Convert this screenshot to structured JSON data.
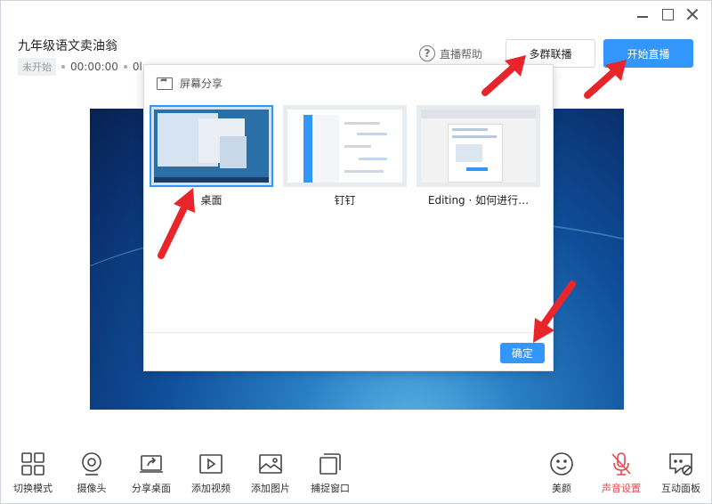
{
  "window": {
    "controls": [
      "minimize",
      "maximize",
      "close"
    ]
  },
  "course": {
    "title": "九年级语文卖油翁",
    "status": "未开始",
    "time": "00:00:00",
    "extra": "0l…"
  },
  "header": {
    "help_label": "直播帮助",
    "help_icon": "question-circle-icon",
    "multi_group_label": "多群联播",
    "start_label": "开始直播"
  },
  "modal": {
    "title": "屏幕分享",
    "title_icon": "screen-share-icon",
    "options": [
      {
        "label": "桌面",
        "selected": true
      },
      {
        "label": "钉钉",
        "selected": false
      },
      {
        "label": "Editing · 如何进行…",
        "selected": false
      }
    ],
    "confirm_label": "确定"
  },
  "toolbar": {
    "left": [
      {
        "label": "切换模式",
        "icon": "grid-icon"
      },
      {
        "label": "摄像头",
        "icon": "camera-icon"
      },
      {
        "label": "分享桌面",
        "icon": "share-desktop-icon"
      },
      {
        "label": "添加视频",
        "icon": "video-icon"
      },
      {
        "label": "添加图片",
        "icon": "image-icon"
      },
      {
        "label": "捕捉窗口",
        "icon": "capture-window-icon"
      }
    ],
    "right": [
      {
        "label": "美颜",
        "icon": "smile-icon"
      },
      {
        "label": "声音设置",
        "icon": "mic-muted-icon",
        "active": true
      },
      {
        "label": "互动面板",
        "icon": "chat-panel-icon"
      }
    ]
  },
  "colors": {
    "accent": "#3296fa",
    "annotation_arrow": "#e8252a",
    "muted_red": "#e5484d"
  }
}
